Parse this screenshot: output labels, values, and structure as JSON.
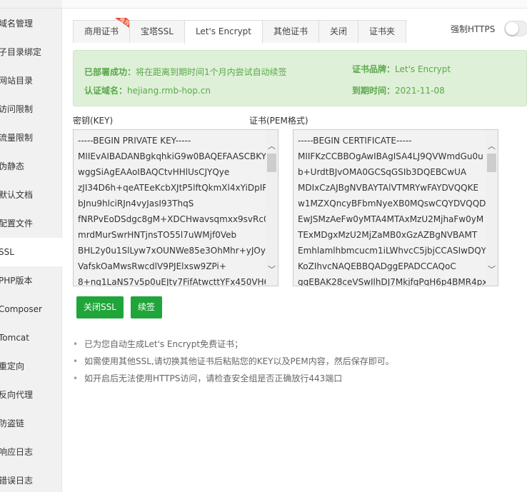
{
  "sidebar": {
    "items": [
      {
        "label": "域名管理"
      },
      {
        "label": "子目录绑定"
      },
      {
        "label": "网站目录"
      },
      {
        "label": "访问限制"
      },
      {
        "label": "流量限制"
      },
      {
        "label": "伪静态"
      },
      {
        "label": "默认文档"
      },
      {
        "label": "配置文件"
      },
      {
        "label": "SSL"
      },
      {
        "label": "PHP版本"
      },
      {
        "label": "Composer"
      },
      {
        "label": "Tomcat"
      },
      {
        "label": "重定向"
      },
      {
        "label": "反向代理"
      },
      {
        "label": "防盗链"
      },
      {
        "label": "响应日志"
      },
      {
        "label": "错误日志"
      }
    ],
    "active_index": 8
  },
  "tabs": [
    {
      "label": "商用证书",
      "badge": "推荐"
    },
    {
      "label": "宝塔SSL"
    },
    {
      "label": "Let's Encrypt"
    },
    {
      "label": "其他证书"
    },
    {
      "label": "关闭"
    },
    {
      "label": "证书夹"
    }
  ],
  "force_https": {
    "label": "强制HTTPS",
    "enabled": false
  },
  "status": {
    "deploy_label": "已部署成功：",
    "deploy_value": "将在距离到期时间1个月内尝试自动续签",
    "domain_label": "认证域名：",
    "domain_value": "hejiang.rmb-hop.cn",
    "brand_label": "证书品牌：",
    "brand_value": "Let's Encrypt",
    "expire_label": "到期时间：",
    "expire_value": "2021-11-08"
  },
  "key": {
    "label": "密钥(KEY)",
    "lines": [
      "-----BEGIN PRIVATE KEY-----",
      "MIIEvAIBADANBgkqhkiG9w0BAQEFAASCBKY",
      "wggSiAgEAAoIBAQCtvHHlUsCJYQye",
      "zJI34D6h+qeATEeKcbXJtP5lftQkmXl4xYiDpIR",
      "bJnu9hlciRJn4vyJasI93ThqS",
      "fNRPvEoDSdgc8gM+XDCHwavsqmxx9svRc0",
      "mrdMurSwrHNTjnsTO55l7uWMjf0Veb",
      "BHL2y0u1SlLyw7xOUNWe85e3OhMhr+yJOyZ",
      "VafskOaMwsRwcdlV9PJElxsw9ZPi+",
      "8+nq1LaNS7v5p0uEJty7FifAtwcttYFx450VH6u"
    ]
  },
  "cert": {
    "label": "证书(PEM格式)",
    "lines": [
      "-----BEGIN CERTIFICATE-----",
      "MIIFKzCCBBOgAwIBAgISA4LJ9QVWmdGu0u",
      "b+UrdtBJvOMA0GCSqGSIb3DQEBCwUA",
      "MDIxCzAJBgNVBAYTAlVTMRYwFAYDVQQKE",
      "w1MZXQncyBFbmNyeXB0MQswCQYDVQQD",
      "EwJSMzAeFw0yMTA4MTAxMzU2MjhaFw0yM",
      "TExMDgxMzU2MjZaMB0xGzAZBgNVBAMT",
      "Emhlamlhbmcucm1iLWhvcC5jbjCCASIwDQYJ",
      "KoZIhvcNAQEBBQADggEPADCCAQoC",
      "ggEBAK28ceVSwIlhDJ7MkjfgPqH6p4BMR4px"
    ]
  },
  "buttons": {
    "close_ssl": "关闭SSL",
    "renew": "续签"
  },
  "notes": [
    "已为您自动生成Let's Encrypt免费证书；",
    "如需使用其他SSL,请切换其他证书后粘贴您的KEY以及PEM内容，然后保存即可。",
    "如开启后无法使用HTTPS访问，请检查安全组是否正确放行443端口"
  ],
  "colors": {
    "accent": "#20a53a",
    "success_bg": "#dff0d8",
    "success_text": "#5aa84a",
    "badge": "#e8452c"
  }
}
